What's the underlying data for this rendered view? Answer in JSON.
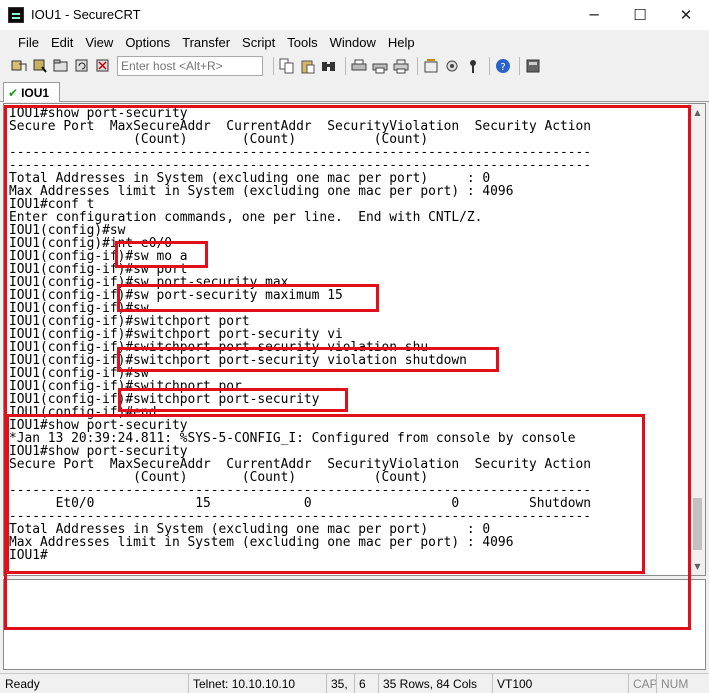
{
  "window": {
    "title": "IOU1 - SecureCRT",
    "minimize_glyph": "─",
    "maximize_glyph": "☐",
    "close_glyph": "✕"
  },
  "menu": [
    "File",
    "Edit",
    "View",
    "Options",
    "Transfer",
    "Script",
    "Tools",
    "Window",
    "Help"
  ],
  "toolbar": {
    "host_placeholder": "Enter host <Alt+R>",
    "left_icons": [
      "connect-icon",
      "quick-connect-icon",
      "connect-in-tab-icon",
      "reconnect-icon",
      "disconnect-icon"
    ],
    "right_icons": [
      "copy-icon",
      "paste-icon",
      "find-icon",
      "print-icon",
      "print-screen-icon",
      "print-setup-icon",
      "session-options-icon",
      "global-options-icon",
      "keymap-icon",
      "help-icon",
      "sftp-icon"
    ]
  },
  "tab": {
    "label": "IOU1",
    "status_icon": "check-icon"
  },
  "terminal": {
    "lines": [
      "IOU1#show port-security",
      "Secure Port  MaxSecureAddr  CurrentAddr  SecurityViolation  Security Action",
      "                (Count)       (Count)          (Count)",
      "---------------------------------------------------------------------------",
      "---------------------------------------------------------------------------",
      "Total Addresses in System (excluding one mac per port)     : 0",
      "Max Addresses limit in System (excluding one mac per port) : 4096",
      "IOU1#conf t",
      "Enter configuration commands, one per line.  End with CNTL/Z.",
      "IOU1(config)#sw",
      "IOU1(config)#int e0/0",
      "IOU1(config-if)#sw mo a",
      "IOU1(config-if)#sw port",
      "IOU1(config-if)#sw port-security max",
      "IOU1(config-if)#sw port-security maximum 15",
      "IOU1(config-if)#sw",
      "IOU1(config-if)#switchport port",
      "IOU1(config-if)#switchport port-security vi",
      "IOU1(config-if)#switchport port-security violation shu",
      "IOU1(config-if)#switchport port-security violation shutdown",
      "IOU1(config-if)#sw",
      "IOU1(config-if)#switchport por",
      "IOU1(config-if)#switchport port-security",
      "IOU1(config-if)#end",
      "IOU1#show port-security",
      "*Jan 13 20:39:24.811: %SYS-5-CONFIG_I: Configured from console by console",
      "IOU1#show port-security",
      "Secure Port  MaxSecureAddr  CurrentAddr  SecurityViolation  Security Action",
      "                (Count)       (Count)          (Count)",
      "---------------------------------------------------------------------------",
      "      Et0/0             15            0                  0         Shutdown",
      "---------------------------------------------------------------------------",
      "Total Addresses in System (excluding one mac per port)     : 0",
      "Max Addresses limit in System (excluding one mac per port) : 4096",
      "IOU1#"
    ]
  },
  "statusbar": {
    "ready": "Ready",
    "connection": "Telnet: 10.10.10.10",
    "row": "35,",
    "col": "6",
    "size": "35 Rows, 84 Cols",
    "emulation": "VT100",
    "cap": "CAP",
    "num": "NUM"
  }
}
